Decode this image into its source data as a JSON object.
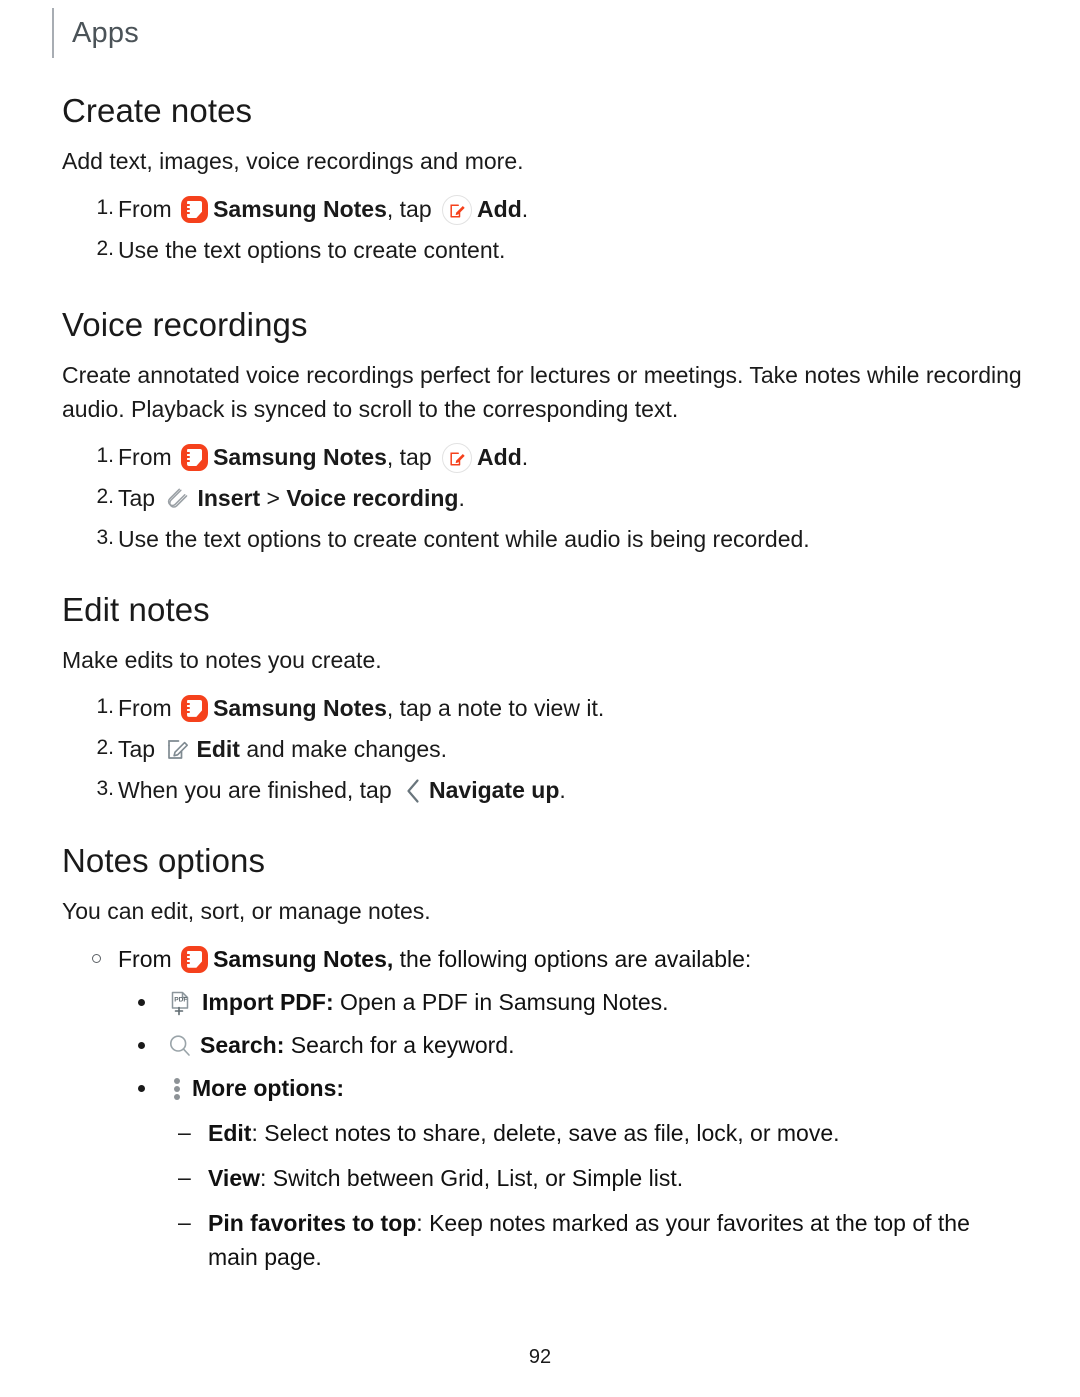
{
  "running_head": {
    "label": "Apps"
  },
  "page_number": "92",
  "colors": {
    "brand_red": "#F5411C",
    "icon_gray": "#8d9296",
    "rule_gray": "#a8adb3",
    "text": "#1a1a1a"
  },
  "sections": [
    {
      "title": "Create notes",
      "lead": "Add text, images, voice recordings and more.",
      "steps": [
        {
          "num": "1.",
          "parts": [
            {
              "type": "text",
              "text": "From "
            },
            {
              "type": "icon",
              "name": "samsung-notes-icon"
            },
            {
              "type": "bold",
              "text": "Samsung Notes"
            },
            {
              "type": "text",
              "text": ", tap "
            },
            {
              "type": "icon",
              "name": "add-icon"
            },
            {
              "type": "bold",
              "text": "Add"
            },
            {
              "type": "text",
              "text": "."
            }
          ]
        },
        {
          "num": "2.",
          "parts": [
            {
              "type": "text",
              "text": "Use the text options to create content."
            }
          ]
        }
      ]
    },
    {
      "title": "Voice recordings",
      "lead": "Create annotated voice recordings perfect for lectures or meetings. Take notes while recording audio. Playback is synced to scroll to the corresponding text.",
      "steps": [
        {
          "num": "1.",
          "parts": [
            {
              "type": "text",
              "text": "From "
            },
            {
              "type": "icon",
              "name": "samsung-notes-icon"
            },
            {
              "type": "bold",
              "text": "Samsung Notes"
            },
            {
              "type": "text",
              "text": ", tap "
            },
            {
              "type": "icon",
              "name": "add-icon"
            },
            {
              "type": "bold",
              "text": "Add"
            },
            {
              "type": "text",
              "text": "."
            }
          ]
        },
        {
          "num": "2.",
          "parts": [
            {
              "type": "text",
              "text": "Tap "
            },
            {
              "type": "icon",
              "name": "paperclip-insert-icon"
            },
            {
              "type": "bold",
              "text": "Insert"
            },
            {
              "type": "text",
              "text": " > "
            },
            {
              "type": "bold",
              "text": "Voice recording"
            },
            {
              "type": "text",
              "text": "."
            }
          ]
        },
        {
          "num": "3.",
          "parts": [
            {
              "type": "text",
              "text": "Use the text options to create content while audio is being recorded."
            }
          ]
        }
      ]
    },
    {
      "title": "Edit notes",
      "lead": "Make edits to notes you create.",
      "steps": [
        {
          "num": "1.",
          "parts": [
            {
              "type": "text",
              "text": "From "
            },
            {
              "type": "icon",
              "name": "samsung-notes-icon"
            },
            {
              "type": "bold",
              "text": "Samsung Notes"
            },
            {
              "type": "text",
              "text": ", tap a note to view it."
            }
          ]
        },
        {
          "num": "2.",
          "parts": [
            {
              "type": "text",
              "text": "Tap "
            },
            {
              "type": "icon",
              "name": "edit-pencil-icon"
            },
            {
              "type": "bold",
              "text": "Edit"
            },
            {
              "type": "text",
              "text": " and make changes."
            }
          ]
        },
        {
          "num": "3.",
          "parts": [
            {
              "type": "text",
              "text": "When you are finished, tap "
            },
            {
              "type": "icon",
              "name": "navigate-up-chevron-icon"
            },
            {
              "type": "bold",
              "text": "Navigate up"
            },
            {
              "type": "text",
              "text": "."
            }
          ]
        }
      ]
    }
  ],
  "notes_options": {
    "title": "Notes options",
    "lead": "You can edit, sort, or manage notes.",
    "intro": {
      "prefix": "From ",
      "app": "Samsung Notes,",
      "suffix": " the following options are available:"
    },
    "options": [
      {
        "icon": "import-pdf-icon",
        "label": "Import PDF",
        "sep": ":",
        "desc": " Open a PDF in Samsung Notes."
      },
      {
        "icon": "search-icon",
        "label": "Search",
        "sep": ":",
        "desc": " Search for a keyword."
      },
      {
        "icon": "more-options-icon",
        "label": "More options",
        "sep": ":",
        "desc": ""
      }
    ],
    "more_options_items": [
      {
        "dash": "–",
        "label": "Edit",
        "sep": ":",
        "desc": " Select notes to share, delete, save as file, lock, or move."
      },
      {
        "dash": "–",
        "label": "View",
        "sep": ":",
        "desc": " Switch between Grid, List, or Simple list."
      },
      {
        "dash": "–",
        "label": "Pin favorites to top",
        "sep": ":",
        "desc": " Keep notes marked as your favorites at the top of the main page."
      }
    ]
  }
}
